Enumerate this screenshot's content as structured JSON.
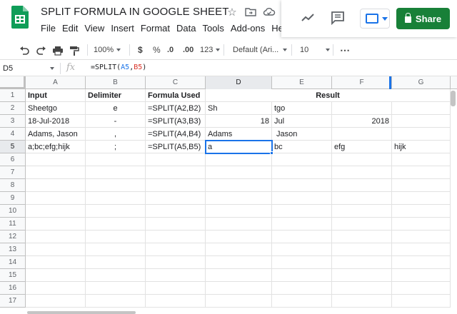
{
  "app": {
    "title": "SPLIT FORMULA IN GOOGLE SHEET",
    "menu": [
      "File",
      "Edit",
      "View",
      "Insert",
      "Format",
      "Data",
      "Tools",
      "Add-ons",
      "He"
    ],
    "share_label": "Share"
  },
  "toolbar": {
    "zoom": "100%",
    "currency": "$",
    "percent": "%",
    "decrease_decimal": ".0",
    "increase_decimal": ".00",
    "more_formats": "123",
    "font": "Default (Ari...",
    "font_size": "10",
    "more": "⋯"
  },
  "formula_bar": {
    "cell_ref": "D5",
    "fx": "fx",
    "prefix": "=SPLIT(",
    "ref1": "A5",
    "comma": ",",
    "ref2": "B5",
    "suffix": ")"
  },
  "columns": [
    "A",
    "B",
    "C",
    "D",
    "E",
    "F",
    "G"
  ],
  "rows": [
    "1",
    "2",
    "3",
    "4",
    "5",
    "6",
    "7",
    "8",
    "9",
    "10",
    "11",
    "12",
    "13",
    "14",
    "15",
    "16",
    "17"
  ],
  "cells": {
    "header": {
      "input": "Input",
      "delimiter": "Delimiter",
      "formula": "Formula Used",
      "result": "Result"
    },
    "r2": {
      "a": "Sheetgo",
      "b": "e",
      "c": "=SPLIT(A2,B2)",
      "d": "Sh",
      "e": "tgo",
      "f": "",
      "g": ""
    },
    "r3": {
      "a": "18-Jul-2018",
      "b": "-",
      "c": "=SPLIT(A3,B3)",
      "d": "18",
      "e": "Jul",
      "f": "2018",
      "g": ""
    },
    "r4": {
      "a": "Adams, Jason",
      "b": ",",
      "c": "=SPLIT(A4,B4)",
      "d": "Adams",
      "e": " Jason",
      "f": "",
      "g": ""
    },
    "r5": {
      "a": "a;bc;efg;hijk",
      "b": ";",
      "c": "=SPLIT(A5,B5)",
      "d": "a",
      "e": "bc",
      "f": "efg",
      "g": "hijk"
    }
  },
  "selected_cell": "D5",
  "colors": {
    "share_green": "#188038",
    "selection_blue": "#1a73e8",
    "ref_red": "#d93025"
  }
}
